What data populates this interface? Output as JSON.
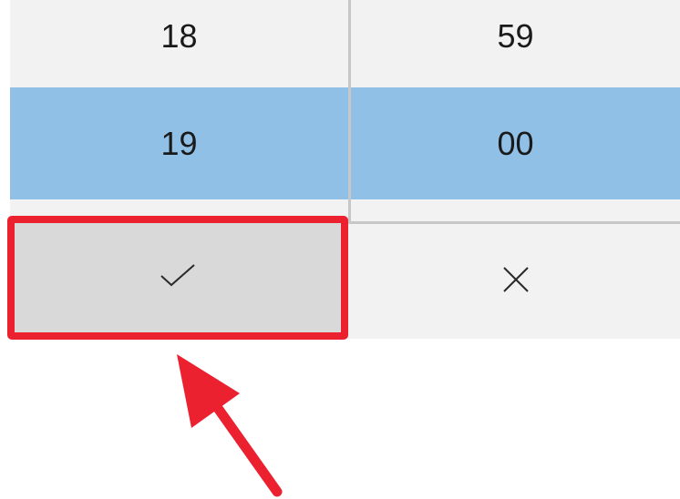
{
  "time_picker": {
    "hour_column": {
      "previous": "18",
      "selected": "19"
    },
    "minute_column": {
      "previous": "59",
      "selected": "00"
    }
  },
  "footer": {
    "accept_icon": "checkmark-icon",
    "dismiss_icon": "close-icon"
  },
  "annotation": {
    "highlight_color": "#ec2130",
    "target": "accept-button"
  },
  "colors": {
    "selection": "#90c0e6",
    "panel": "#f2f2f2",
    "accept_bg": "#d9d9d9",
    "annotation": "#ec2130"
  }
}
